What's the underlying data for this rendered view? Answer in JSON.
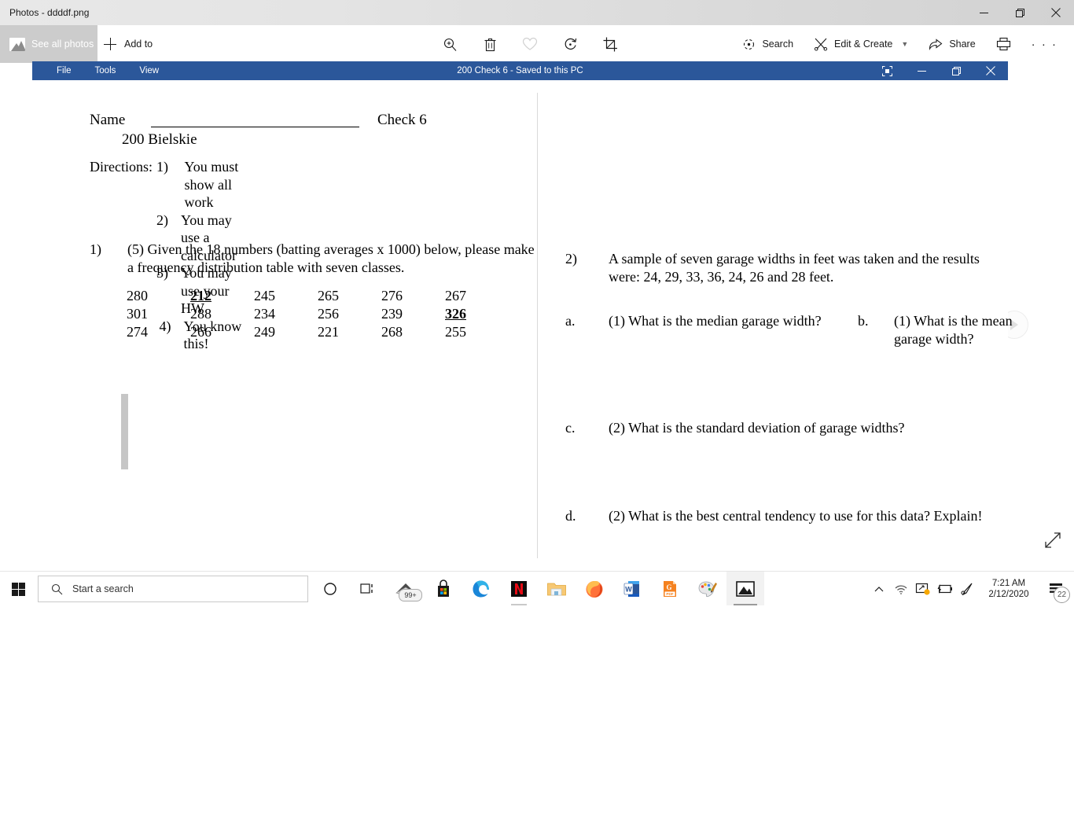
{
  "window": {
    "title": "Photos - ddddf.png",
    "controls": [
      "minimize",
      "restore",
      "close"
    ]
  },
  "command_bar": {
    "see_all_photos": "See all photos",
    "add_to": "Add to",
    "center_tools": [
      {
        "name": "zoom-icon",
        "label": "Zoom"
      },
      {
        "name": "delete-icon",
        "label": "Delete"
      },
      {
        "name": "favorite-icon",
        "label": "Add to favorites"
      },
      {
        "name": "rotate-icon",
        "label": "Rotate"
      },
      {
        "name": "crop-icon",
        "label": "Crop & rotate"
      }
    ],
    "search": "Search",
    "edit_create": "Edit & Create",
    "share": "Share",
    "print": "Print",
    "more": "· · ·"
  },
  "word_window": {
    "menu": [
      "File",
      "Tools",
      "View"
    ],
    "title": "200 Check 6  -  Saved to this PC",
    "controls": [
      "ribbon-display-options",
      "minimize",
      "restore",
      "close"
    ]
  },
  "document": {
    "name_label": "Name",
    "check_label": "Check 6",
    "name_value": "200 Bielskie",
    "directions_heading": "Directions:",
    "directions": [
      {
        "num": "1)",
        "text": "You must show all work"
      },
      {
        "num": "2)",
        "text": "You may use a calculator"
      },
      {
        "num": "3)",
        "text": "You may use your HW"
      },
      {
        "num": "4)",
        "text": "You know this!"
      }
    ],
    "question1": {
      "num": "1)",
      "text": "(5) Given the 18 numbers (batting averages x 1000) below, please make a frequency distribution table with seven classes."
    },
    "numbers": {
      "rows": [
        [
          {
            "v": "280",
            "bold": false
          },
          {
            "v": "212",
            "bold": true
          },
          {
            "v": "245",
            "bold": false
          },
          {
            "v": "265",
            "bold": false
          },
          {
            "v": "276",
            "bold": false
          },
          {
            "v": "267",
            "bold": false
          }
        ],
        [
          {
            "v": "301",
            "bold": false
          },
          {
            "v": "288",
            "bold": false
          },
          {
            "v": "234",
            "bold": false
          },
          {
            "v": "256",
            "bold": false
          },
          {
            "v": "239",
            "bold": false
          },
          {
            "v": "326",
            "bold": true
          }
        ],
        [
          {
            "v": "274",
            "bold": false
          },
          {
            "v": "266",
            "bold": false
          },
          {
            "v": "249",
            "bold": false
          },
          {
            "v": "221",
            "bold": false
          },
          {
            "v": "268",
            "bold": false
          },
          {
            "v": "255",
            "bold": false
          }
        ]
      ]
    },
    "question2": {
      "num": "2)",
      "text": "A sample of seven garage widths in feet was taken and the results were: 24, 29, 33, 36, 24, 26 and 28 feet.",
      "part_a_label": "a.",
      "part_a": "(1) What is the median garage width?",
      "part_b_label": "b.",
      "part_b": "(1) What is the mean garage width?",
      "part_c_label": "c.",
      "part_c": "(2) What is the standard deviation of garage widths?",
      "part_d_label": "d.",
      "part_d": "(2) What is the best central tendency to use for this data?  Explain!"
    }
  },
  "taskbar": {
    "search_placeholder": "Start a search",
    "items": [
      {
        "name": "cortana-icon",
        "label": "Cortana"
      },
      {
        "name": "task-view-icon",
        "label": "Task View"
      },
      {
        "name": "mail-icon",
        "label": "Mail",
        "badge": "99+"
      },
      {
        "name": "microsoft-store-icon",
        "label": "Microsoft Store"
      },
      {
        "name": "edge-icon",
        "label": "Microsoft Edge"
      },
      {
        "name": "netflix-icon",
        "label": "Netflix"
      },
      {
        "name": "file-explorer-icon",
        "label": "File Explorer"
      },
      {
        "name": "firefox-icon",
        "label": "Firefox"
      },
      {
        "name": "word-icon",
        "label": "Microsoft Word"
      },
      {
        "name": "foxit-pdf-icon",
        "label": "PDF Reader"
      },
      {
        "name": "paint-icon",
        "label": "Paint"
      },
      {
        "name": "photos-icon",
        "label": "Photos"
      }
    ],
    "tray": {
      "time": "7:21 AM",
      "date": "2/12/2020",
      "notification_count": "22"
    }
  },
  "colors": {
    "word_blue": "#2b579a",
    "command_bar_bg": "#ffffff",
    "see_all_bg": "#cccccc",
    "taskbar_bg": "#ffffff"
  }
}
